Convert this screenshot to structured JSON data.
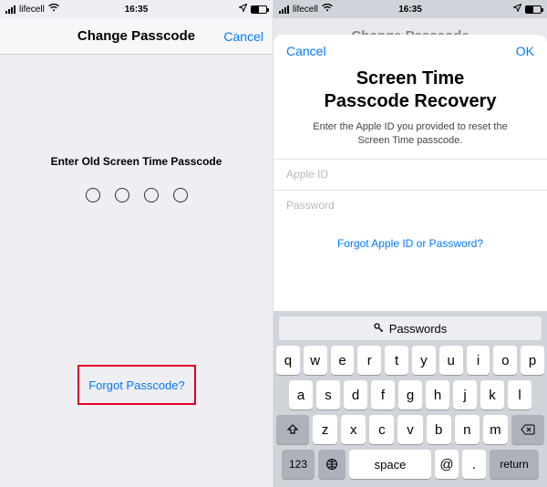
{
  "status": {
    "carrier": "lifecell",
    "time": "16:35"
  },
  "left": {
    "nav_title": "Change Passcode",
    "nav_cancel": "Cancel",
    "prompt": "Enter Old Screen Time Passcode",
    "forgot": "Forgot Passcode?"
  },
  "right": {
    "dim_title": "Change Passcode",
    "cancel": "Cancel",
    "ok": "OK",
    "title_line1": "Screen Time",
    "title_line2": "Passcode Recovery",
    "subtitle": "Enter the Apple ID you provided to reset the Screen Time passcode.",
    "apple_id_placeholder": "Apple ID",
    "password_placeholder": "Password",
    "forgot": "Forgot Apple ID or Password?",
    "passwords_bar": "Passwords"
  },
  "keyboard": {
    "row1": [
      "q",
      "w",
      "e",
      "r",
      "t",
      "y",
      "u",
      "i",
      "o",
      "p"
    ],
    "row2": [
      "a",
      "s",
      "d",
      "f",
      "g",
      "h",
      "j",
      "k",
      "l"
    ],
    "row3": [
      "z",
      "x",
      "c",
      "v",
      "b",
      "n",
      "m"
    ],
    "numbers": "123",
    "space": "space",
    "at": "@",
    "dot": ".",
    "return": "return"
  }
}
